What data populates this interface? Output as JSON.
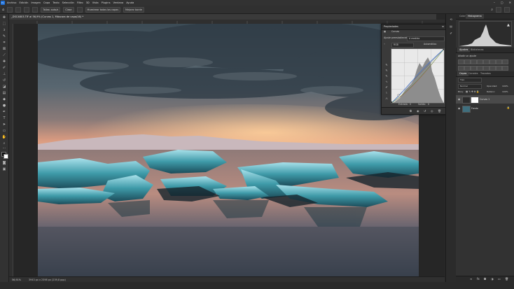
{
  "menubar": {
    "app_icon": "Ps",
    "items": [
      "Archivo",
      "Edición",
      "Imagen",
      "Capa",
      "Texto",
      "Selección",
      "Filtro",
      "3D",
      "Vista",
      "Plugins",
      "Ventana",
      "Ayuda"
    ]
  },
  "options_bar": {
    "label_tamano": "Tamaño",
    "field_tamano": "Tallas: auto/s",
    "field_clase": "Clase",
    "field_muestra": "Muestrear todas las capas",
    "field_mejorar": "Mejorar borde"
  },
  "document": {
    "tab_title": "_DSC4803.TIF al 56,9% (Curvas 1, Máscara de capa/16) *",
    "zoom": "56,91%",
    "doc_info": "3943 px x 2398 px (239,8 ppp)"
  },
  "properties_panel": {
    "title": "Propiedades",
    "adjustment_name": "Curvas",
    "preset_label": "Ajuste preestablecido:",
    "preset_value": "A medida",
    "channel_value": "RGB",
    "auto_label": "Automático",
    "input_label": "Entrada:",
    "output_label": "Salida:",
    "input_value": "0",
    "output_value": "0"
  },
  "dock": {
    "tab_color": "Color",
    "tab_histogram": "Histograma",
    "tab_adjustments": "Ajustes",
    "tab_libraries": "Bibliotecas",
    "add_adjustment_label": "Añadir un ajuste",
    "tab_layers": "Capas",
    "tab_channels": "Canales",
    "tab_paths": "Trazados",
    "filter_kind": "Tipo",
    "blend_mode": "Normal",
    "opacity_label": "Opacidad:",
    "opacity_value": "100%",
    "lock_label": "Bloq:",
    "fill_label": "Relleno:",
    "fill_value": "100%",
    "layers": [
      {
        "name": "Curvas 1",
        "kind": "adjustment"
      },
      {
        "name": "Fondo",
        "kind": "image"
      }
    ]
  },
  "colors": {
    "accent": "#1e6fd9",
    "panel_bg": "#323232",
    "workspace_bg": "#282828"
  }
}
